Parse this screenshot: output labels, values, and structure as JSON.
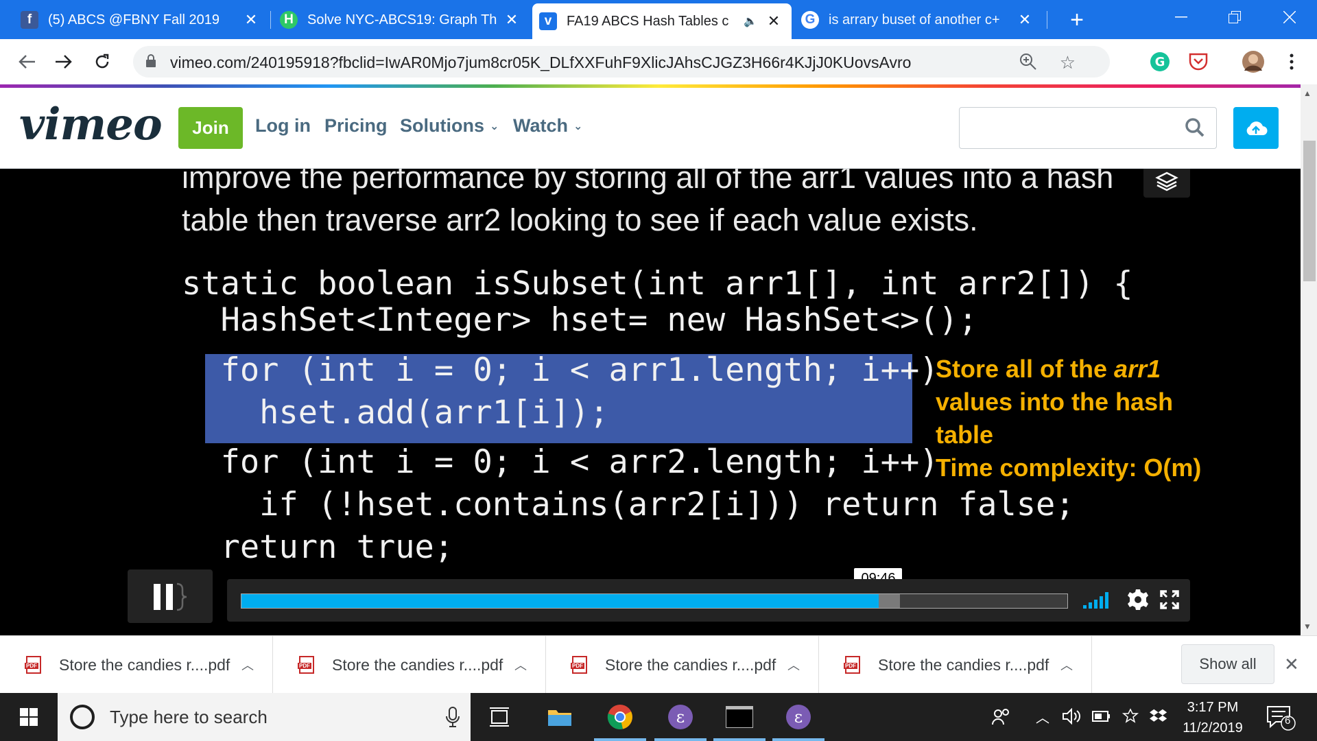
{
  "browser": {
    "tabs": [
      {
        "title": "(5) ABCS @FBNY Fall 2019",
        "icon": "facebook-icon",
        "active": false
      },
      {
        "title": "Solve NYC-ABCS19: Graph Th",
        "icon": "hackerrank-icon",
        "active": false
      },
      {
        "title": "FA19 ABCS Hash Tables c",
        "icon": "vimeo-icon",
        "active": true
      },
      {
        "title": "is arrary buset of another c+",
        "icon": "google-icon",
        "active": false
      }
    ],
    "url": "vimeo.com/240195918?fbclid=IwAR0Mjo7jum8cr05K_DLfXXFuhF9XlicJAhsCJGZ3H66r4KJjJ0KUovsAvro"
  },
  "vimeo": {
    "logo": "vimeo",
    "join": "Join",
    "nav": [
      "Log in",
      "Pricing",
      "Solutions",
      "Watch"
    ],
    "brand_green": "#6cb828",
    "brand_blue": "#00adef"
  },
  "video": {
    "description": "improve the performance by storing all of the arr1 values into a hash table then traverse arr2 looking to see if each value exists.",
    "code": [
      "static boolean isSubset(int arr1[], int arr2[]) {",
      "  HashSet<Integer> hset= new HashSet<>();",
      "  for (int i = 0; i < arr1.length; i++)",
      "    hset.add(arr1[i]);",
      "  for (int i = 0; i < arr2.length; i++)",
      "    if (!hset.contains(arr2[i])) return false;",
      "  return true;"
    ],
    "note": {
      "line1_prefix": "Store all of the ",
      "line1_em": "arr1",
      "line2": "values into the hash",
      "line3": "table",
      "line4": "Time complexity: O(m)"
    },
    "highlight_color": "#3d5aa8",
    "note_color": "#f5b000",
    "time": "09:46",
    "progress": 0.772,
    "buffered": 0.797
  },
  "downloads": {
    "items": [
      "Store the candies r....pdf",
      "Store the candies r....pdf",
      "Store the candies r....pdf",
      "Store the candies r....pdf"
    ],
    "show_all": "Show all"
  },
  "taskbar": {
    "search_placeholder": "Type here to search",
    "time": "3:17 PM",
    "date": "11/2/2019",
    "notifications": "6"
  }
}
